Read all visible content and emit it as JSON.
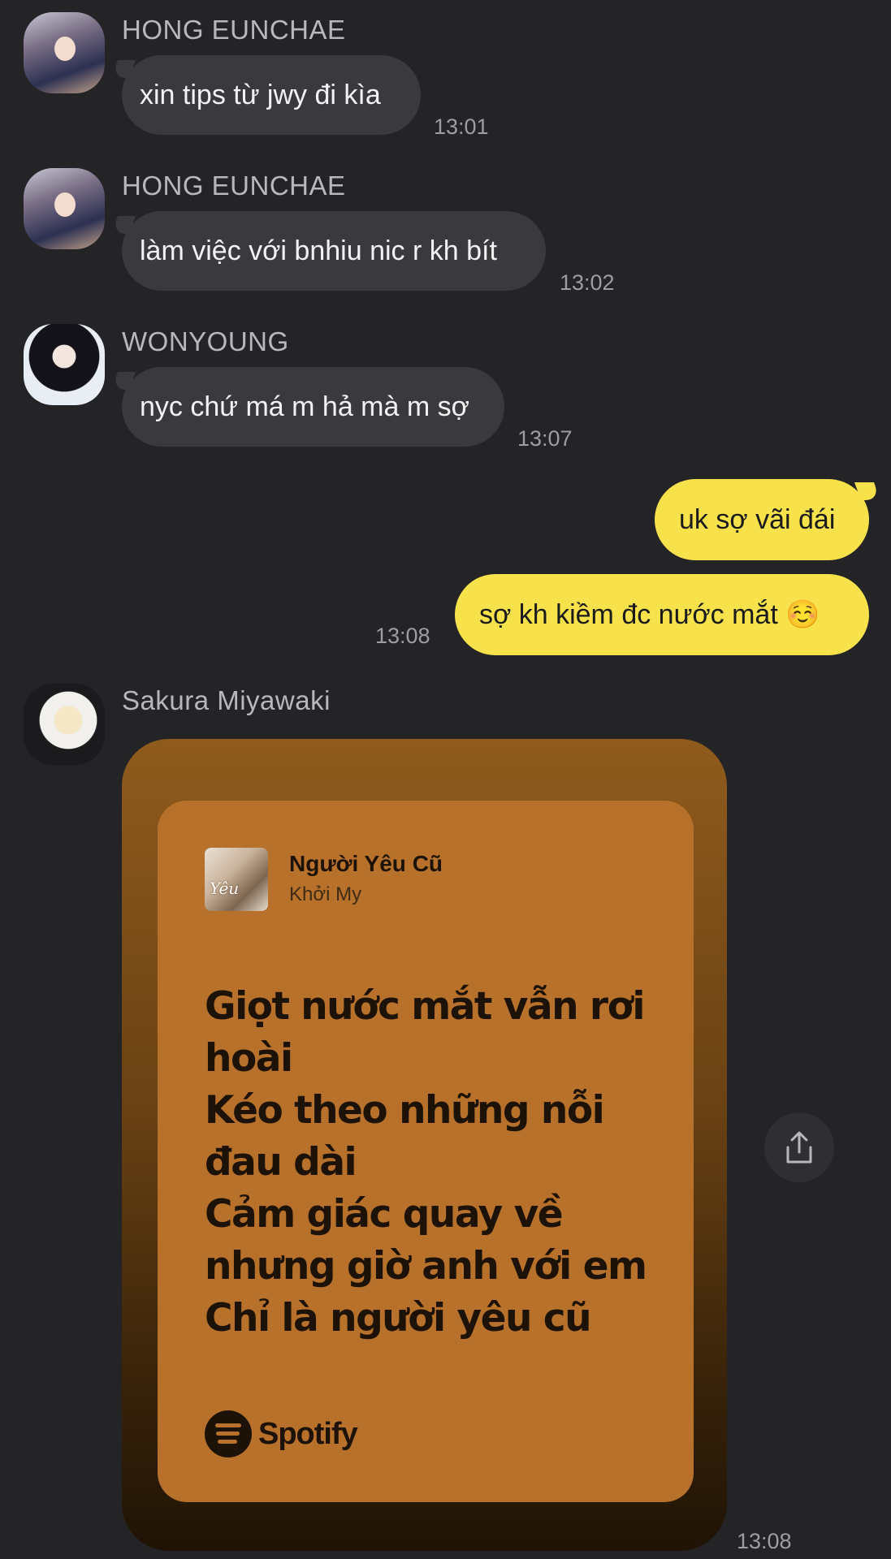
{
  "messages": [
    {
      "sender": "HONG EUNCHAE",
      "text": "xin tips từ jwy đi kìa",
      "time": "13:01"
    },
    {
      "sender": "HONG EUNCHAE",
      "text": "làm việc với bnhiu nic r kh bít",
      "time": "13:02"
    },
    {
      "sender": "WONYOUNG",
      "text": "nyc chứ má m hả mà m sợ",
      "time": "13:07"
    }
  ],
  "outgoing": [
    {
      "text": "uk sợ vãi đái"
    },
    {
      "text": "sợ kh kiềm đc nước mắt ☺️",
      "time": "13:08"
    }
  ],
  "share": {
    "sender": "Sakura Miyawaki",
    "time": "13:08",
    "album_art_text": "Yêu",
    "song_title": "Người Yêu Cũ",
    "artist": "Khởi My",
    "lyrics": [
      "Giọt nước mắt vẫn rơi",
      "hoài",
      "Kéo theo những nỗi",
      "đau dài",
      "Cảm giác quay về",
      "nhưng giờ anh với em",
      "Chỉ là người yêu cũ"
    ],
    "brand": "Spotify"
  },
  "colors": {
    "background": "#242427",
    "incoming_bubble": "#3a3a3d",
    "outgoing_bubble": "#f7e24b",
    "card_accent": "#b7712a"
  },
  "icons": {
    "share": "share-icon"
  }
}
